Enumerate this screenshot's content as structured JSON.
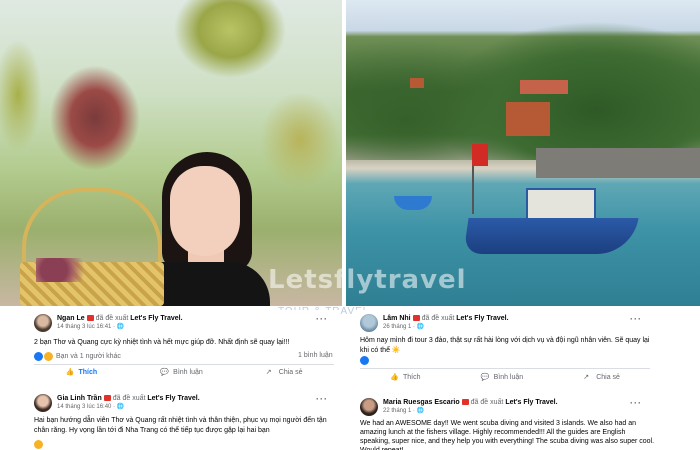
{
  "watermark": {
    "brand": "Letsflytravel",
    "sub": "TOUR & TRAVEL"
  },
  "posts": [
    {
      "author": "Ngan Le",
      "recommend_text": "đã đề xuất",
      "page": "Let's Fly Travel.",
      "time": "14 tháng 3 lúc 16:41 · ",
      "body": "2 bạn Thơ và Quang cực kỳ nhiệt tình và hết mực giúp đỡ. Nhất định sẽ quay lại!!!",
      "reactions_text": "Bạn và 1 người khác",
      "comments": "1 bình luận",
      "actions": {
        "like": "Thích",
        "comment": "Bình luận",
        "share": "Chia sẻ"
      }
    },
    {
      "author": "Gia Linh Trần",
      "recommend_text": "đã đề xuất",
      "page": "Let's Fly Travel.",
      "time": "14 tháng 3 lúc 16:40 · ",
      "body": "Hai bạn hướng dẫn viên Thơ và Quang rất nhiệt tình và thân thiện, phục vụ mọi người đến tận chân răng. Hy vọng lần tới đi Nha Trang có thể tiếp tục được gặp lại hai bạn"
    },
    {
      "author": "Lâm Nhi",
      "recommend_text": "đã đề xuất",
      "page": "Let's Fly Travel.",
      "time": "26 tháng 1 · ",
      "body": "Hôm nay mình đi tour 3 đảo, thật sự rất hài lòng với dịch vụ và đội ngũ nhân viên. Sẽ quay lại khi có thể",
      "actions": {
        "like": "Thích",
        "comment": "Bình luận",
        "share": "Chia sẻ"
      }
    },
    {
      "author": "Maria Ruesgas Escario",
      "recommend_text": "đã đề xuất",
      "page": "Let's Fly Travel.",
      "time": "22 tháng 1 · ",
      "body": "We had an AWESOME day!! We went scuba diving and visited 3 islands. We also had an amazing lunch at the fishers village. Highly recommended!!! All the guides are English speaking, super nice, and they help you with everything! The scuba diving was also super cool. Would repeat!"
    }
  ],
  "colors": {
    "facebook_blue": "#1877f2",
    "muted": "#65676b"
  }
}
